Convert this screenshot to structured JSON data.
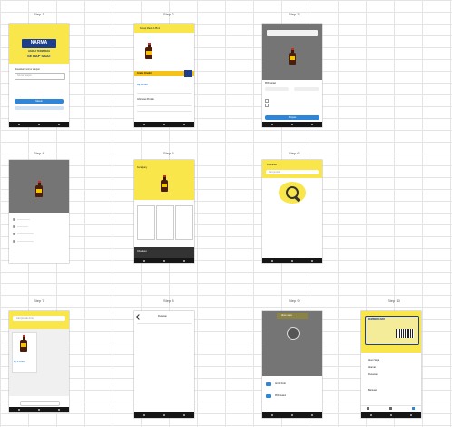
{
  "steps": [
    "Step 1",
    "Step 2",
    "Step 3",
    "Step 4",
    "Step 5",
    "Step 6",
    "Step 7",
    "Step 8",
    "Step 9",
    "Step 10"
  ],
  "s1": {
    "brand": "NARMA",
    "tagline1": "HARGA TERMURAH",
    "tagline2": "SETIAP SAAT",
    "prompt": "Masukkan nomor telepon",
    "phone_placeholder": "Nomor telepon",
    "cta": "Masuk"
  },
  "s2": {
    "header": "Kecap Manis 135ml",
    "banner": "Gratis Ongkir",
    "price": "Rp 14.500",
    "section": "Informasi Produk"
  },
  "s3": {
    "button": "Simpan",
    "option1": "Pilih varian"
  },
  "s5": {
    "title": "Keranjang",
    "button": "Checkout"
  },
  "s6": {
    "header": "Pencarian",
    "placeholder": "Cari produk"
  },
  "s7": {
    "search": "Cari produk di sini",
    "price": "Rp 14.500"
  },
  "s8": {
    "title": "Pesanan"
  },
  "s9": {
    "header": "Akun saya",
    "option1": "Ambil Foto",
    "option2": "Pilih Galeri"
  },
  "s10": {
    "card_title": "MEMBER CARD",
    "menu": [
      "Akun Saya",
      "Alamat",
      "Pesanan",
      "Bantuan"
    ]
  },
  "colors": {
    "accent": "#f9e64a",
    "primary": "#2f86d8",
    "navy": "#1e3e8c"
  }
}
